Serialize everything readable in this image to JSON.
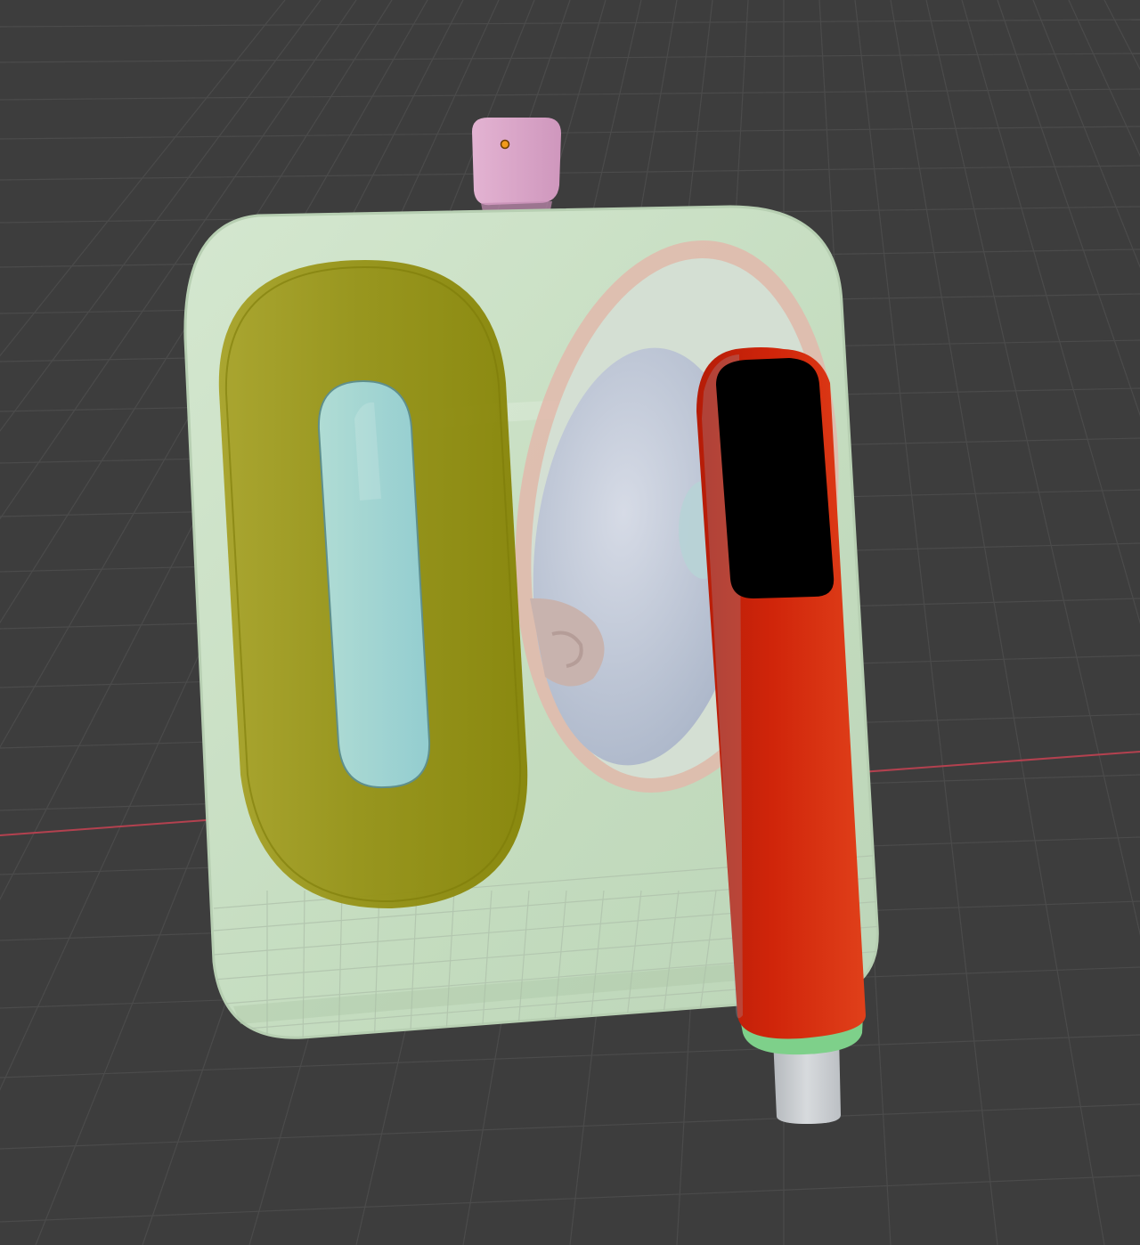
{
  "app": {
    "view": "3d-viewport"
  },
  "viewport": {
    "background_color": "#3d3d3d",
    "grid_line_color": "#4b4b4b",
    "x_axis_color": "#b3414f",
    "object_origin_color": "#f29a1b"
  },
  "scene_objects": [
    {
      "name": "hanger-loop",
      "color": "#d8a2c6"
    },
    {
      "name": "box-body",
      "color": "#c9e2c4"
    },
    {
      "name": "oval-frame",
      "color": "#9c9a1e"
    },
    {
      "name": "oval-window",
      "color": "#9fd4d0"
    },
    {
      "name": "round-door-ring",
      "color": "#e2b8ac"
    },
    {
      "name": "round-door-glass",
      "color": "#c4cad8"
    },
    {
      "name": "handheld-device",
      "color": "#d42a0e"
    },
    {
      "name": "device-screen",
      "color": "#000000"
    },
    {
      "name": "device-band",
      "color": "#7ed08a"
    },
    {
      "name": "device-connector",
      "color": "#c8cbcf"
    }
  ]
}
